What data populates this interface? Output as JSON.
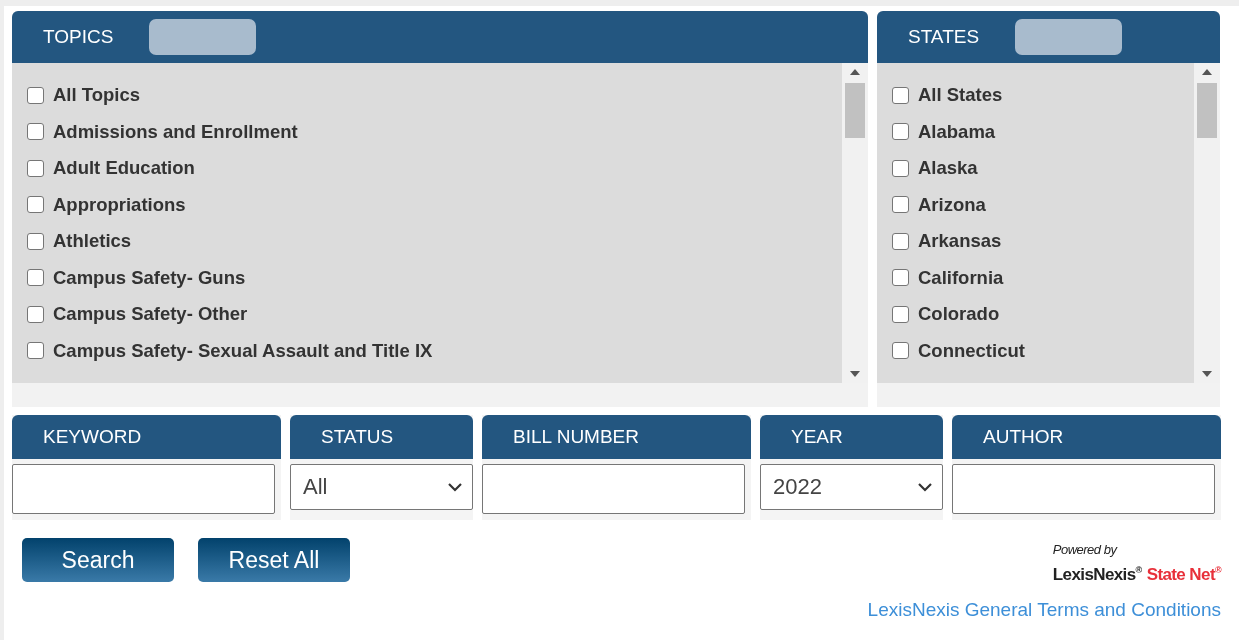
{
  "topics": {
    "title": "TOPICS",
    "items": [
      {
        "label": "All Topics",
        "checked": false
      },
      {
        "label": "Admissions and Enrollment",
        "checked": false
      },
      {
        "label": "Adult Education",
        "checked": false
      },
      {
        "label": "Appropriations",
        "checked": false
      },
      {
        "label": "Athletics",
        "checked": false
      },
      {
        "label": "Campus Safety- Guns",
        "checked": false
      },
      {
        "label": "Campus Safety- Other",
        "checked": false
      },
      {
        "label": "Campus Safety- Sexual Assault and Title IX",
        "checked": false
      }
    ]
  },
  "states": {
    "title": "STATES",
    "items": [
      {
        "label": "All States",
        "checked": false
      },
      {
        "label": "Alabama",
        "checked": false
      },
      {
        "label": "Alaska",
        "checked": false
      },
      {
        "label": "Arizona",
        "checked": false
      },
      {
        "label": "Arkansas",
        "checked": false
      },
      {
        "label": "California",
        "checked": false
      },
      {
        "label": "Colorado",
        "checked": false
      },
      {
        "label": "Connecticut",
        "checked": false
      }
    ]
  },
  "filters": [
    {
      "kind": "text",
      "label": "KEYWORD"
    },
    {
      "kind": "select",
      "label": "STATUS",
      "value": "All"
    },
    {
      "kind": "text",
      "label": "BILL NUMBER"
    },
    {
      "kind": "select",
      "label": "YEAR",
      "value": "2022"
    },
    {
      "kind": "text",
      "label": "AUTHOR"
    }
  ],
  "buttons": [
    "Search",
    "Reset All"
  ],
  "powered_by": {
    "caption": "Powered by",
    "brand": "LexisNexis$^{®}$",
    "product": "State Net$^{®}$"
  },
  "terms_link": "LexisNexis General Terms and Conditions"
}
